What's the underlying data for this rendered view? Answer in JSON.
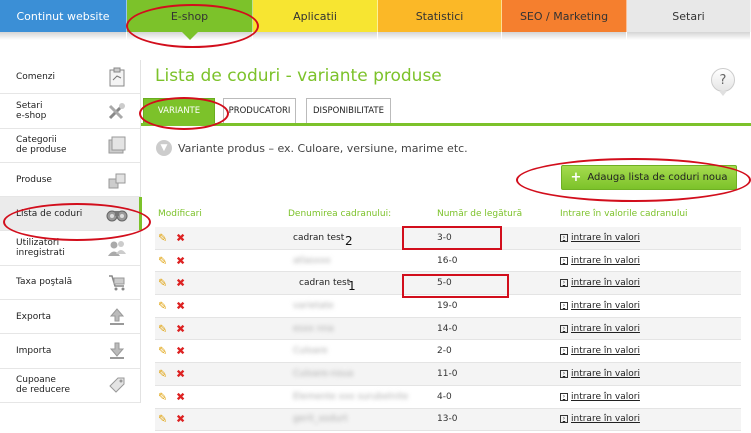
{
  "nav": [
    {
      "label": "Continut website",
      "color": "#3b8fd6"
    },
    {
      "label": "E-shop",
      "color": "#7cc22a"
    },
    {
      "label": "Aplicatii",
      "color": "#f7e531"
    },
    {
      "label": "Statistici",
      "color": "#fbb827"
    },
    {
      "label": "SEO / Marketing",
      "color": "#f57f2e"
    },
    {
      "label": "Setari",
      "color": "#e8e8e8"
    }
  ],
  "sidebar": [
    {
      "label": "Comenzi",
      "icon": "clipboard-icon"
    },
    {
      "label": "Setari\ne-shop",
      "icon": "tools-icon"
    },
    {
      "label": "Categorii\nde produse",
      "icon": "folders-icon"
    },
    {
      "label": "Produse",
      "icon": "boxes-icon"
    },
    {
      "label": "Lista de coduri",
      "icon": "binoculars-icon"
    },
    {
      "label": "Utilizatori\ninregistrati",
      "icon": "users-icon"
    },
    {
      "label": "Taxa poştală",
      "icon": "cart-icon"
    },
    {
      "label": "Exporta",
      "icon": "export-icon"
    },
    {
      "label": "Importa",
      "icon": "import-icon"
    },
    {
      "label": "Cupoane\nde reducere",
      "icon": "tag-icon"
    }
  ],
  "page": {
    "title": "Lista de coduri - variante produse",
    "help": "?",
    "subtabs": [
      "VARIANTE",
      "PRODUCATORI",
      "DISPONIBILITATE"
    ],
    "description": "Variante produs – ex. Culoare, versiune, marime etc.",
    "add_button": "Adauga lista de coduri noua"
  },
  "table": {
    "headers": [
      "Modificari",
      "Denumirea cadranului:",
      "Număr de legătură",
      "Intrare în valorile cadranului"
    ],
    "link_label": "intrare în valori",
    "rows": [
      {
        "name": "cadran test",
        "num": "3-0"
      },
      {
        "name": "atlasxxx",
        "num": "16-0"
      },
      {
        "name": "cadran test",
        "num": "5-0"
      },
      {
        "name": "varietate",
        "num": "19-0"
      },
      {
        "name": "esxx nna",
        "num": "14-0"
      },
      {
        "name": "Culoare",
        "num": "2-0"
      },
      {
        "name": "Culoare-noua",
        "num": "11-0"
      },
      {
        "name": "Elemente xxx surubelnite",
        "num": "4-0"
      },
      {
        "name": "gerit_xodurt",
        "num": "13-0"
      }
    ]
  },
  "annotations": {
    "n2": "2",
    "n1": "1"
  }
}
